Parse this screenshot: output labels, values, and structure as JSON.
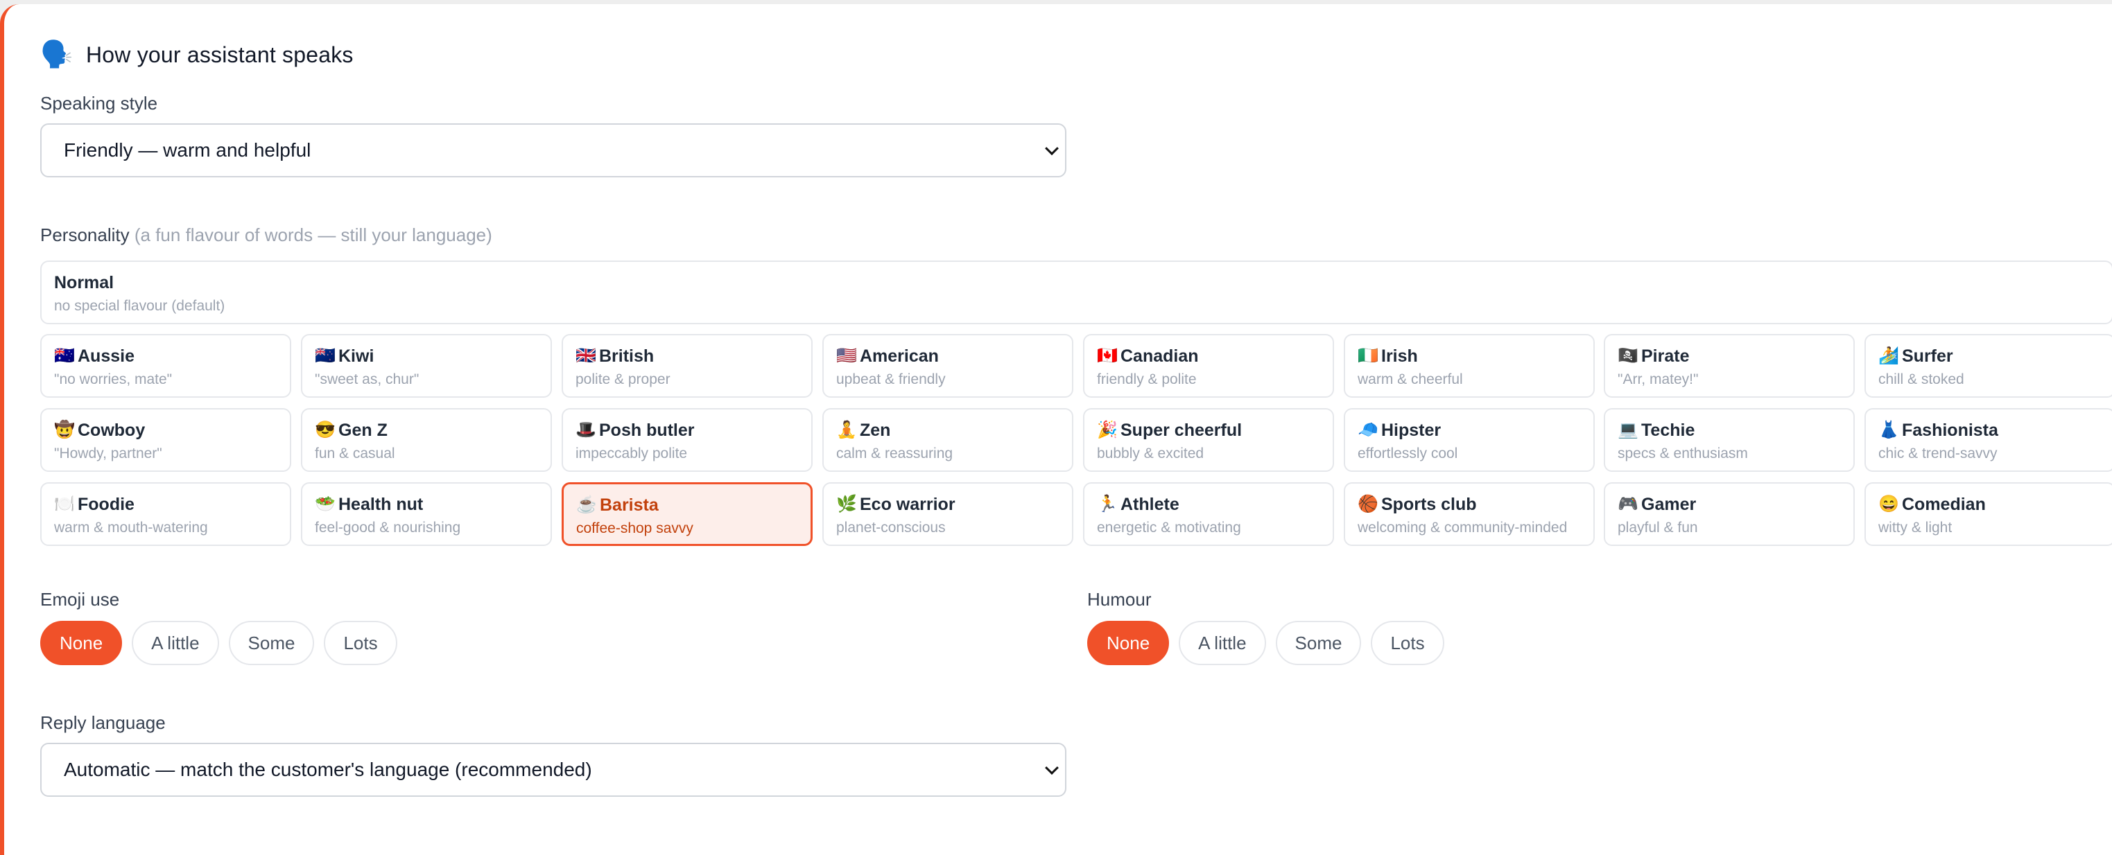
{
  "header": {
    "emoji": "🗣️",
    "title": "How your assistant speaks"
  },
  "speaking_style": {
    "label": "Speaking style",
    "value": "Friendly — warm and helpful"
  },
  "personality": {
    "label": "Personality",
    "hint": "(a fun flavour of words — still your language)",
    "normal": {
      "name": "Normal",
      "desc": "no special flavour (default)"
    },
    "selected": "Barista",
    "options": [
      {
        "icon": "🇦🇺",
        "name": "Aussie",
        "desc": "\"no worries, mate\""
      },
      {
        "icon": "🇳🇿",
        "name": "Kiwi",
        "desc": "\"sweet as, chur\""
      },
      {
        "icon": "🇬🇧",
        "name": "British",
        "desc": "polite & proper"
      },
      {
        "icon": "🇺🇸",
        "name": "American",
        "desc": "upbeat & friendly"
      },
      {
        "icon": "🇨🇦",
        "name": "Canadian",
        "desc": "friendly & polite"
      },
      {
        "icon": "🇮🇪",
        "name": "Irish",
        "desc": "warm & cheerful"
      },
      {
        "icon": "🏴‍☠️",
        "name": "Pirate",
        "desc": "\"Arr, matey!\""
      },
      {
        "icon": "🏄",
        "name": "Surfer",
        "desc": "chill & stoked"
      },
      {
        "icon": "🤠",
        "name": "Cowboy",
        "desc": "\"Howdy, partner\""
      },
      {
        "icon": "😎",
        "name": "Gen Z",
        "desc": "fun & casual"
      },
      {
        "icon": "🎩",
        "name": "Posh butler",
        "desc": "impeccably polite"
      },
      {
        "icon": "🧘",
        "name": "Zen",
        "desc": "calm & reassuring"
      },
      {
        "icon": "🎉",
        "name": "Super cheerful",
        "desc": "bubbly & excited"
      },
      {
        "icon": "🧢",
        "name": "Hipster",
        "desc": "effortlessly cool"
      },
      {
        "icon": "💻",
        "name": "Techie",
        "desc": "specs & enthusiasm"
      },
      {
        "icon": "👗",
        "name": "Fashionista",
        "desc": "chic & trend-savvy"
      },
      {
        "icon": "🍽️",
        "name": "Foodie",
        "desc": "warm & mouth-watering"
      },
      {
        "icon": "🥗",
        "name": "Health nut",
        "desc": "feel-good & nourishing"
      },
      {
        "icon": "☕",
        "name": "Barista",
        "desc": "coffee-shop savvy"
      },
      {
        "icon": "🌿",
        "name": "Eco warrior",
        "desc": "planet-conscious"
      },
      {
        "icon": "🏃",
        "name": "Athlete",
        "desc": "energetic & motivating"
      },
      {
        "icon": "🏀",
        "name": "Sports club",
        "desc": "welcoming & community-minded"
      },
      {
        "icon": "🎮",
        "name": "Gamer",
        "desc": "playful & fun"
      },
      {
        "icon": "😄",
        "name": "Comedian",
        "desc": "witty & light"
      }
    ]
  },
  "emoji_use": {
    "label": "Emoji use",
    "options": [
      "None",
      "A little",
      "Some",
      "Lots"
    ],
    "selected": "None"
  },
  "humour": {
    "label": "Humour",
    "options": [
      "None",
      "A little",
      "Some",
      "Lots"
    ],
    "selected": "None"
  },
  "reply_language": {
    "label": "Reply language",
    "value": "Automatic — match the customer's language (recommended)"
  },
  "colors": {
    "accent": "#f05129",
    "selected_bg": "#fdeeea"
  }
}
